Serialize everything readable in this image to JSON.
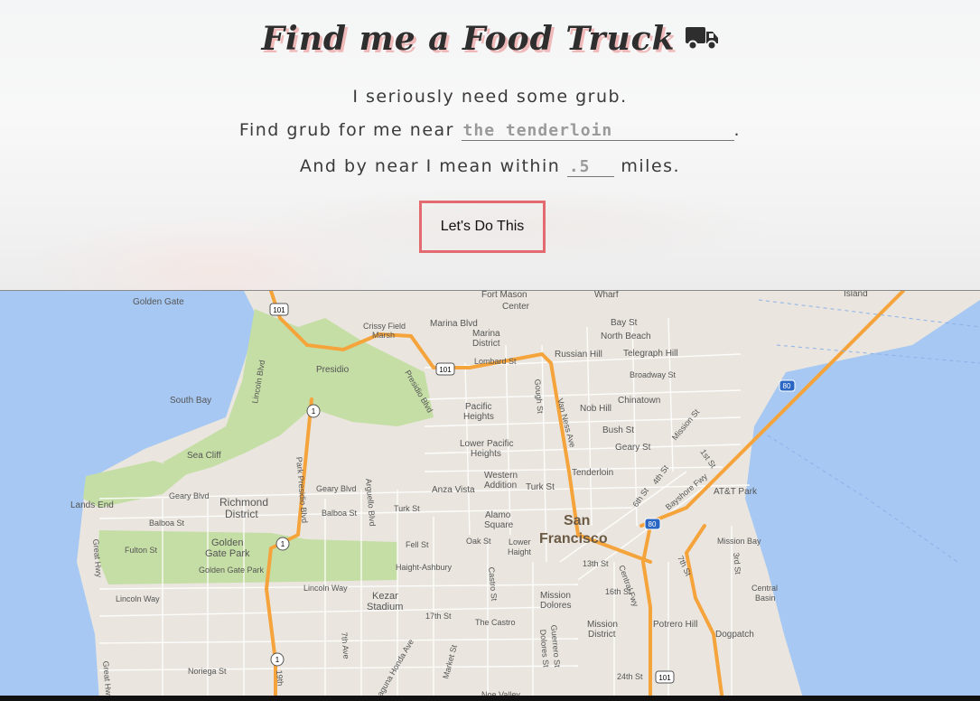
{
  "header": {
    "title": "Find me a Food Truck",
    "line1": "I seriously need some grub.",
    "line2_prefix": "Find grub for me near",
    "location_value": "the tenderloin",
    "line2_suffix": ".",
    "line3_prefix": "And by near I mean within",
    "radius_value": ".5",
    "line3_suffix": "miles.",
    "button_label": "Let's Do This"
  },
  "icons": {
    "title_icon": "truck-icon"
  },
  "colors": {
    "button_border": "#e36a6f",
    "title_shadow": "#f0b9b9",
    "water": "#a6c8f2",
    "land": "#eae6df",
    "park": "#c5dea5",
    "highway": "#f5a33b"
  },
  "map": {
    "city_label": [
      "San",
      "Francisco"
    ],
    "place_labels": [
      "Golden Gate",
      "Fort Mason",
      "Center",
      "Wharf",
      "Island",
      "Crissy Field",
      "Marsh",
      "Marina Blvd",
      "Marina",
      "District",
      "Bay St",
      "North Beach",
      "Russian Hill",
      "Telegraph Hill",
      "Lombard St",
      "Presidio",
      "Presidio Blvd",
      "Lincoln Blvd",
      "Broadway St",
      "South Bay",
      "Pacific",
      "Heights",
      "Chinatown",
      "Nob Hill",
      "Bush St",
      "Gough St",
      "Van Ness Ave",
      "Mission St",
      "1st St",
      "Lower Pacific",
      "Heights",
      "Geary St",
      "Sea Cliff",
      "Tenderloin",
      "4th St",
      "Western",
      "Addition",
      "Turk St",
      "Anza Vista",
      "AT&T Park",
      "6th St",
      "Bayshore Fwy",
      "Lands End",
      "Geary Blvd",
      "Richmond",
      "District",
      "Geary Blvd",
      "Arguello Blvd",
      "Park Presidio Blvd",
      "Balboa St",
      "Balboa St",
      "Turk St",
      "Alamo",
      "Square",
      "Golden",
      "Gate Park",
      "Fulton St",
      "Fell St",
      "Oak St",
      "Lower",
      "Haight",
      "Mission Bay",
      "Great Hwy",
      "Haight-Ashbury",
      "13th St",
      "Central Fwy",
      "7th St",
      "3rd St",
      "Lincoln Way",
      "Lincoln Way",
      "Kezar",
      "Stadium",
      "Castro St",
      "Mission",
      "Dolores",
      "16th St",
      "Central",
      "Basin",
      "17th St",
      "The Castro",
      "Potrero Hill",
      "Mission",
      "District",
      "Dogpatch",
      "7th Ave",
      "Noriega St",
      "Guerrero St",
      "Dolores St",
      "Market St",
      "24th St",
      "19th",
      "Noe Valley",
      "Laguna Honda Ave",
      "Great Hwy",
      "Golden Gate Park"
    ],
    "shields": [
      "101",
      "101",
      "1",
      "1",
      "1",
      "80",
      "80",
      "101"
    ]
  }
}
